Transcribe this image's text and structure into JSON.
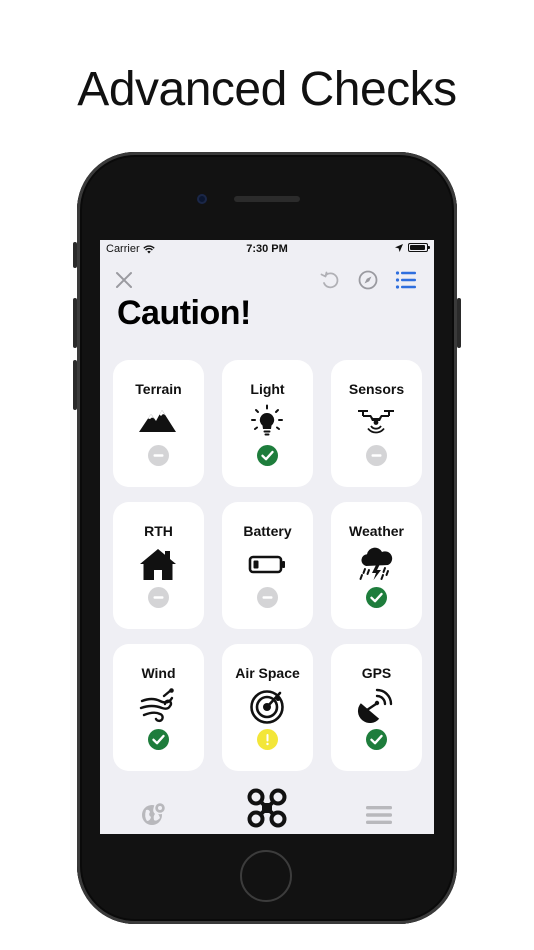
{
  "headline": "Advanced Checks",
  "status_bar": {
    "carrier": "Carrier",
    "time": "7:30 PM"
  },
  "nav": {
    "close_icon": "close-icon",
    "refresh_icon": "refresh-icon",
    "compass_icon": "compass-icon",
    "list_icon": "list-icon"
  },
  "title": "Caution!",
  "checks": [
    {
      "label": "Terrain",
      "icon": "mountain-icon",
      "status": "neutral"
    },
    {
      "label": "Light",
      "icon": "lightbulb-icon",
      "status": "ok"
    },
    {
      "label": "Sensors",
      "icon": "drone-sensor-icon",
      "status": "neutral"
    },
    {
      "label": "RTH",
      "icon": "home-icon",
      "status": "neutral"
    },
    {
      "label": "Battery",
      "icon": "battery-low-icon",
      "status": "neutral"
    },
    {
      "label": "Weather",
      "icon": "storm-cloud-icon",
      "status": "ok"
    },
    {
      "label": "Wind",
      "icon": "wind-icon",
      "status": "ok"
    },
    {
      "label": "Air Space",
      "icon": "radar-icon",
      "status": "warning"
    },
    {
      "label": "GPS",
      "icon": "satellite-dish-icon",
      "status": "ok"
    }
  ],
  "tabs": [
    {
      "icon": "map-globe-icon",
      "active": false
    },
    {
      "icon": "drone-icon",
      "active": true
    },
    {
      "icon": "menu-icon",
      "active": false
    }
  ],
  "colors": {
    "ok": "#1e7d3c",
    "neutral": "#d4d4d6",
    "warning": "#f3e639",
    "accent": "#2f6fde",
    "inactive": "#b8b8bc"
  }
}
